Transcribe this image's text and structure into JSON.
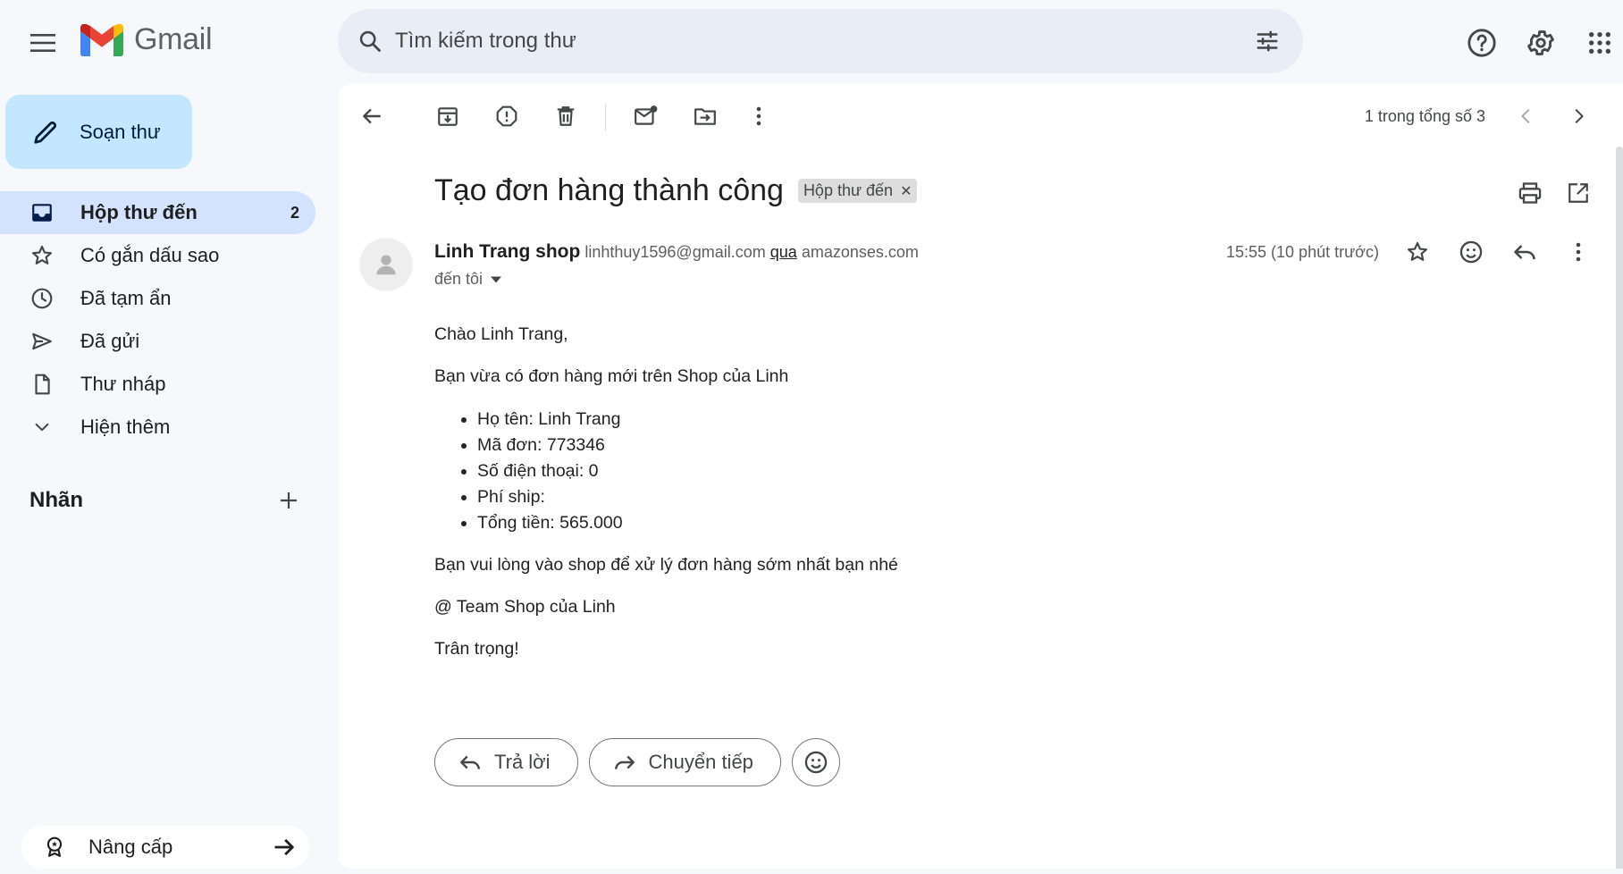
{
  "app": {
    "name": "Gmail"
  },
  "search": {
    "placeholder": "Tìm kiếm trong thư"
  },
  "compose": {
    "label": "Soạn thư"
  },
  "sidebar": {
    "items": [
      {
        "label": "Hộp thư đến",
        "count": "2",
        "icon": "inbox-icon"
      },
      {
        "label": "Có gắn dấu sao",
        "icon": "star-icon"
      },
      {
        "label": "Đã tạm ẩn",
        "icon": "clock-icon"
      },
      {
        "label": "Đã gửi",
        "icon": "send-icon"
      },
      {
        "label": "Thư nháp",
        "icon": "draft-icon"
      },
      {
        "label": "Hiện thêm",
        "icon": "chevron-down-icon"
      }
    ],
    "labels_title": "Nhãn",
    "upgrade_label": "Nâng cấp"
  },
  "toolbar": {
    "pager": "1 trong tổng số 3"
  },
  "email": {
    "subject": "Tạo đơn hàng thành công",
    "label_chip": "Hộp thư đến",
    "sender_name": "Linh Trang shop",
    "sender_email": "linhthuy1596@gmail.com",
    "via_word": "qua",
    "via_domain": "amazonses.com",
    "to": "đến tôi",
    "time": "15:55 (10 phút trước)",
    "body": {
      "greeting": "Chào Linh Trang,",
      "intro": "Bạn vừa có đơn hàng mới trên Shop của Linh",
      "items": [
        "Họ tên: Linh Trang",
        "Mã đơn: 773346",
        "Số điện thoại: 0",
        "Phí ship:",
        "Tổng tiền: 565.000"
      ],
      "request": "Bạn vui lòng vào shop để xử lý đơn hàng sớm nhất bạn nhé",
      "team": "@ Team Shop của Linh",
      "closing": "Trân trọng!"
    }
  },
  "actions": {
    "reply_label": "Trả lời",
    "forward_label": "Chuyển tiếp"
  },
  "colors": {
    "accent": "#c2e7ff",
    "active_nav": "#d3e3fd",
    "background": "#f6f8fc",
    "search_bg": "#e9eef6"
  }
}
